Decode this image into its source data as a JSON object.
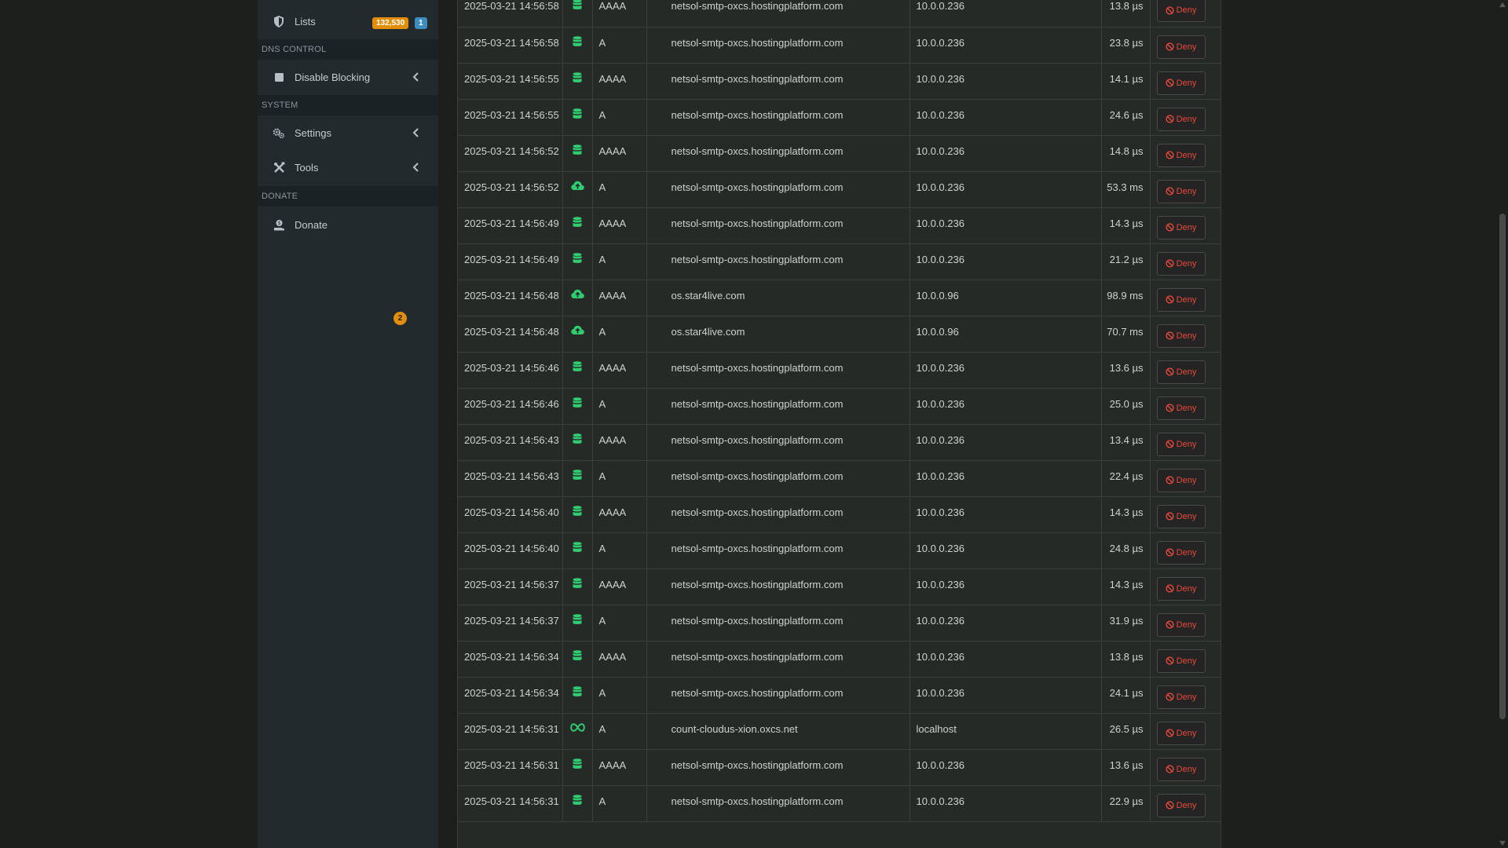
{
  "sidebar": {
    "lists": {
      "label": "Lists",
      "badge_total": "132,530",
      "badge_groups": "1"
    },
    "dns_control_header": "DNS CONTROL",
    "disable_blocking": {
      "label": "Disable Blocking"
    },
    "system_header": "SYSTEM",
    "settings": {
      "label": "Settings"
    },
    "tools": {
      "label": "Tools",
      "badge": "2"
    },
    "donate_header": "DONATE",
    "donate": {
      "label": "Donate"
    }
  },
  "colors": {
    "ok_green": "#2fcc71",
    "deny_red": "#e8493a",
    "badge_orange": "#e08e0b",
    "badge_blue": "#3c8dbc"
  },
  "deny_label": "Deny",
  "rows": [
    {
      "time": "2025-03-21 14:56:58",
      "status": "cache",
      "type": "AAAA",
      "domain": "netsol-smtp-oxcs.hostingplatform.com",
      "client": "10.0.0.236",
      "reply": "13.8 µs"
    },
    {
      "time": "2025-03-21 14:56:58",
      "status": "cache",
      "type": "A",
      "domain": "netsol-smtp-oxcs.hostingplatform.com",
      "client": "10.0.0.236",
      "reply": "23.8 µs"
    },
    {
      "time": "2025-03-21 14:56:55",
      "status": "cache",
      "type": "AAAA",
      "domain": "netsol-smtp-oxcs.hostingplatform.com",
      "client": "10.0.0.236",
      "reply": "14.1 µs"
    },
    {
      "time": "2025-03-21 14:56:55",
      "status": "cache",
      "type": "A",
      "domain": "netsol-smtp-oxcs.hostingplatform.com",
      "client": "10.0.0.236",
      "reply": "24.6 µs"
    },
    {
      "time": "2025-03-21 14:56:52",
      "status": "cache",
      "type": "AAAA",
      "domain": "netsol-smtp-oxcs.hostingplatform.com",
      "client": "10.0.0.236",
      "reply": "14.8 µs"
    },
    {
      "time": "2025-03-21 14:56:52",
      "status": "forwarded",
      "type": "A",
      "domain": "netsol-smtp-oxcs.hostingplatform.com",
      "client": "10.0.0.236",
      "reply": "53.3 ms"
    },
    {
      "time": "2025-03-21 14:56:49",
      "status": "cache",
      "type": "AAAA",
      "domain": "netsol-smtp-oxcs.hostingplatform.com",
      "client": "10.0.0.236",
      "reply": "14.3 µs"
    },
    {
      "time": "2025-03-21 14:56:49",
      "status": "cache",
      "type": "A",
      "domain": "netsol-smtp-oxcs.hostingplatform.com",
      "client": "10.0.0.236",
      "reply": "21.2 µs"
    },
    {
      "time": "2025-03-21 14:56:48",
      "status": "forwarded",
      "type": "AAAA",
      "domain": "os.star4live.com",
      "client": "10.0.0.96",
      "reply": "98.9 ms"
    },
    {
      "time": "2025-03-21 14:56:48",
      "status": "forwarded",
      "type": "A",
      "domain": "os.star4live.com",
      "client": "10.0.0.96",
      "reply": "70.7 ms"
    },
    {
      "time": "2025-03-21 14:56:46",
      "status": "cache",
      "type": "AAAA",
      "domain": "netsol-smtp-oxcs.hostingplatform.com",
      "client": "10.0.0.236",
      "reply": "13.6 µs"
    },
    {
      "time": "2025-03-21 14:56:46",
      "status": "cache",
      "type": "A",
      "domain": "netsol-smtp-oxcs.hostingplatform.com",
      "client": "10.0.0.236",
      "reply": "25.0 µs"
    },
    {
      "time": "2025-03-21 14:56:43",
      "status": "cache",
      "type": "AAAA",
      "domain": "netsol-smtp-oxcs.hostingplatform.com",
      "client": "10.0.0.236",
      "reply": "13.4 µs"
    },
    {
      "time": "2025-03-21 14:56:43",
      "status": "cache",
      "type": "A",
      "domain": "netsol-smtp-oxcs.hostingplatform.com",
      "client": "10.0.0.236",
      "reply": "22.4 µs"
    },
    {
      "time": "2025-03-21 14:56:40",
      "status": "cache",
      "type": "AAAA",
      "domain": "netsol-smtp-oxcs.hostingplatform.com",
      "client": "10.0.0.236",
      "reply": "14.3 µs"
    },
    {
      "time": "2025-03-21 14:56:40",
      "status": "cache",
      "type": "A",
      "domain": "netsol-smtp-oxcs.hostingplatform.com",
      "client": "10.0.0.236",
      "reply": "24.8 µs"
    },
    {
      "time": "2025-03-21 14:56:37",
      "status": "cache",
      "type": "AAAA",
      "domain": "netsol-smtp-oxcs.hostingplatform.com",
      "client": "10.0.0.236",
      "reply": "14.3 µs"
    },
    {
      "time": "2025-03-21 14:56:37",
      "status": "cache",
      "type": "A",
      "domain": "netsol-smtp-oxcs.hostingplatform.com",
      "client": "10.0.0.236",
      "reply": "31.9 µs"
    },
    {
      "time": "2025-03-21 14:56:34",
      "status": "cache",
      "type": "AAAA",
      "domain": "netsol-smtp-oxcs.hostingplatform.com",
      "client": "10.0.0.236",
      "reply": "13.8 µs"
    },
    {
      "time": "2025-03-21 14:56:34",
      "status": "cache",
      "type": "A",
      "domain": "netsol-smtp-oxcs.hostingplatform.com",
      "client": "10.0.0.236",
      "reply": "24.1 µs"
    },
    {
      "time": "2025-03-21 14:56:31",
      "status": "local",
      "type": "A",
      "domain": "count-cloudus-xion.oxcs.net",
      "client": "localhost",
      "reply": "26.5 µs"
    },
    {
      "time": "2025-03-21 14:56:31",
      "status": "cache",
      "type": "AAAA",
      "domain": "netsol-smtp-oxcs.hostingplatform.com",
      "client": "10.0.0.236",
      "reply": "13.6 µs"
    },
    {
      "time": "2025-03-21 14:56:31",
      "status": "cache",
      "type": "A",
      "domain": "netsol-smtp-oxcs.hostingplatform.com",
      "client": "10.0.0.236",
      "reply": "22.9 µs"
    }
  ]
}
